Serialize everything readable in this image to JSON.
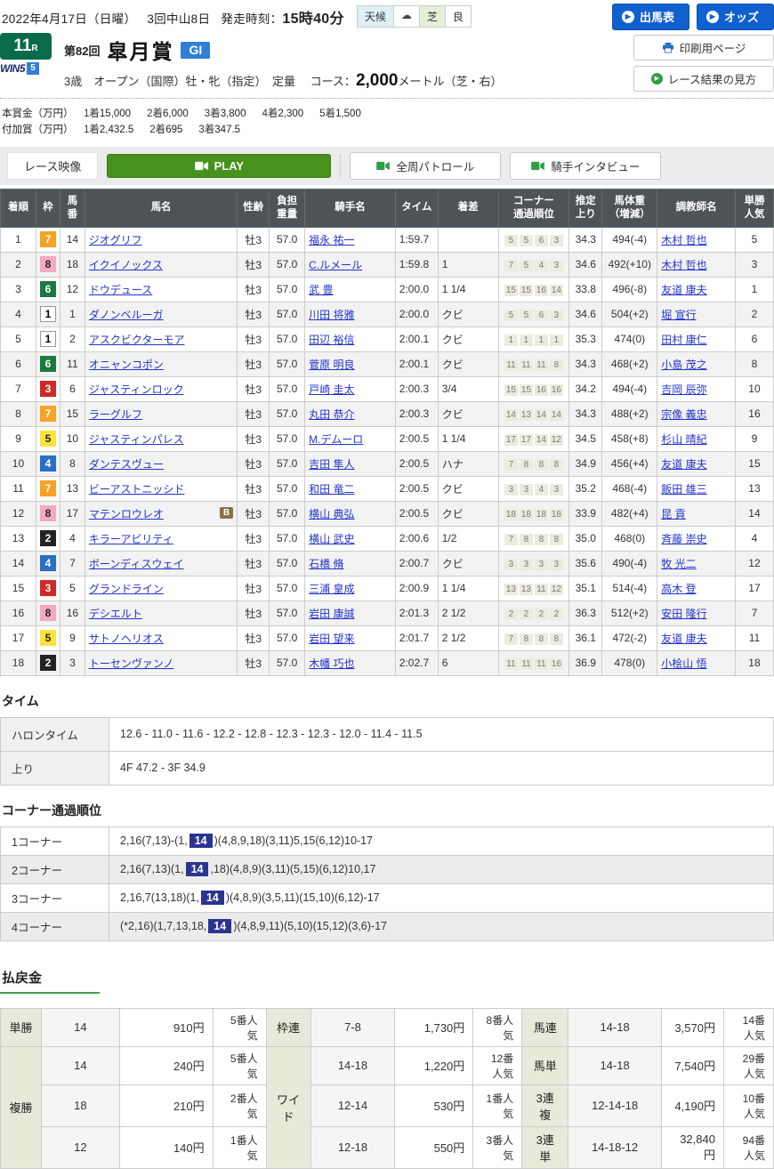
{
  "icons": {
    "play_arrow": "▶",
    "cloud": "☁"
  },
  "header": {
    "date": "2022年4月17日（日曜）",
    "meet": "3回中山8日",
    "start_label": "発走時刻：",
    "start_time": "15時40分",
    "weather_label": "天候",
    "turf_label": "芝",
    "turf_value": "良",
    "btn_entry": "出馬表",
    "btn_odds": "オッズ",
    "btn_print": "印刷用ページ",
    "btn_guide": "レース結果の見方"
  },
  "race": {
    "number": "11",
    "number_suffix": "R",
    "win5": "WIN5",
    "win5_num": "5",
    "edition": "第82回",
    "name": "皐月賞",
    "grade": "GI",
    "conditions": "3歳　オープン（国際）牡・牝（指定）　定量",
    "course_label": "コース：",
    "course_distance": "2,000",
    "course_detail": "メートル（芝・右）"
  },
  "prize": {
    "main_label": "本賞金（万円）",
    "added_label": "付加賞（万円）",
    "main": [
      [
        "1着",
        "15,000"
      ],
      [
        "2着",
        "6,000"
      ],
      [
        "3着",
        "3,800"
      ],
      [
        "4着",
        "2,300"
      ],
      [
        "5着",
        "1,500"
      ]
    ],
    "added": [
      [
        "1着",
        "2,432.5"
      ],
      [
        "2着",
        "695"
      ],
      [
        "3着",
        "347.5"
      ]
    ]
  },
  "video": {
    "race_video": "レース映像",
    "play": "PLAY",
    "patrol": "全周パトロール",
    "interview": "騎手インタビュー"
  },
  "results": {
    "headers": [
      "着順",
      "枠",
      "馬\n番",
      "馬名",
      "性齢",
      "負担\n重量",
      "騎手名",
      "タイム",
      "着差",
      "コーナー\n通過順位",
      "推定\n上り",
      "馬体重\n（増減）",
      "調教師名",
      "単勝\n人気"
    ],
    "rows": [
      {
        "pos": "1",
        "waku": "7",
        "num": "14",
        "name": "ジオグリフ",
        "badge": "",
        "sa": "牡3",
        "wt": "57.0",
        "jockey": "福永 祐一",
        "time": "1:59.7",
        "margin": "",
        "corners": [
          "5",
          "5",
          "6",
          "3"
        ],
        "agari": "34.3",
        "hw": "494(-4)",
        "trainer": "木村 哲也",
        "ninki": "5"
      },
      {
        "pos": "2",
        "waku": "8",
        "num": "18",
        "name": "イクイノックス",
        "badge": "",
        "sa": "牡3",
        "wt": "57.0",
        "jockey": "C.ルメール",
        "time": "1:59.8",
        "margin": "1",
        "corners": [
          "7",
          "5",
          "4",
          "3"
        ],
        "agari": "34.6",
        "hw": "492(+10)",
        "trainer": "木村 哲也",
        "ninki": "3"
      },
      {
        "pos": "3",
        "waku": "6",
        "num": "12",
        "name": "ドウデュース",
        "badge": "",
        "sa": "牡3",
        "wt": "57.0",
        "jockey": "武 豊",
        "time": "2:00.0",
        "margin": "1 1/4",
        "corners": [
          "15",
          "15",
          "16",
          "14"
        ],
        "agari": "33.8",
        "hw": "496(-8)",
        "trainer": "友道 康夫",
        "ninki": "1"
      },
      {
        "pos": "4",
        "waku": "1",
        "num": "1",
        "name": "ダノンベルーガ",
        "badge": "",
        "sa": "牡3",
        "wt": "57.0",
        "jockey": "川田 将雅",
        "time": "2:00.0",
        "margin": "クビ",
        "corners": [
          "5",
          "5",
          "6",
          "3"
        ],
        "agari": "34.6",
        "hw": "504(+2)",
        "trainer": "堀 宣行",
        "ninki": "2"
      },
      {
        "pos": "5",
        "waku": "1",
        "num": "2",
        "name": "アスクビクターモア",
        "badge": "",
        "sa": "牡3",
        "wt": "57.0",
        "jockey": "田辺 裕信",
        "time": "2:00.1",
        "margin": "クビ",
        "corners": [
          "1",
          "1",
          "1",
          "1"
        ],
        "agari": "35.3",
        "hw": "474(0)",
        "trainer": "田村 康仁",
        "ninki": "6"
      },
      {
        "pos": "6",
        "waku": "6",
        "num": "11",
        "name": "オニャンコポン",
        "badge": "",
        "sa": "牡3",
        "wt": "57.0",
        "jockey": "菅原 明良",
        "time": "2:00.1",
        "margin": "クビ",
        "corners": [
          "11",
          "11",
          "11",
          "8"
        ],
        "agari": "34.3",
        "hw": "468(+2)",
        "trainer": "小島 茂之",
        "ninki": "8"
      },
      {
        "pos": "7",
        "waku": "3",
        "num": "6",
        "name": "ジャスティンロック",
        "badge": "",
        "sa": "牡3",
        "wt": "57.0",
        "jockey": "戸崎 圭太",
        "time": "2:00.3",
        "margin": "3/4",
        "corners": [
          "15",
          "15",
          "16",
          "16"
        ],
        "agari": "34.2",
        "hw": "494(-4)",
        "trainer": "吉岡 辰弥",
        "ninki": "10"
      },
      {
        "pos": "8",
        "waku": "7",
        "num": "15",
        "name": "ラーグルフ",
        "badge": "",
        "sa": "牡3",
        "wt": "57.0",
        "jockey": "丸田 恭介",
        "time": "2:00.3",
        "margin": "クビ",
        "corners": [
          "14",
          "13",
          "14",
          "14"
        ],
        "agari": "34.3",
        "hw": "488(+2)",
        "trainer": "宗像 義忠",
        "ninki": "16"
      },
      {
        "pos": "9",
        "waku": "5",
        "num": "10",
        "name": "ジャスティンパレス",
        "badge": "",
        "sa": "牡3",
        "wt": "57.0",
        "jockey": "M.デムーロ",
        "time": "2:00.5",
        "margin": "1 1/4",
        "corners": [
          "17",
          "17",
          "14",
          "12"
        ],
        "agari": "34.5",
        "hw": "458(+8)",
        "trainer": "杉山 晴紀",
        "ninki": "9"
      },
      {
        "pos": "10",
        "waku": "4",
        "num": "8",
        "name": "ダンテスヴュー",
        "badge": "",
        "sa": "牡3",
        "wt": "57.0",
        "jockey": "吉田 隼人",
        "time": "2:00.5",
        "margin": "ハナ",
        "corners": [
          "7",
          "8",
          "8",
          "8"
        ],
        "agari": "34.9",
        "hw": "456(+4)",
        "trainer": "友道 康夫",
        "ninki": "15"
      },
      {
        "pos": "11",
        "waku": "7",
        "num": "13",
        "name": "ビーアストニッシド",
        "badge": "",
        "sa": "牡3",
        "wt": "57.0",
        "jockey": "和田 竜二",
        "time": "2:00.5",
        "margin": "クビ",
        "corners": [
          "3",
          "3",
          "4",
          "3"
        ],
        "agari": "35.2",
        "hw": "468(-4)",
        "trainer": "飯田 雄三",
        "ninki": "13"
      },
      {
        "pos": "12",
        "waku": "8",
        "num": "17",
        "name": "マテンロウレオ",
        "badge": "B",
        "sa": "牡3",
        "wt": "57.0",
        "jockey": "横山 典弘",
        "time": "2:00.5",
        "margin": "クビ",
        "corners": [
          "18",
          "18",
          "18",
          "18"
        ],
        "agari": "33.9",
        "hw": "482(+4)",
        "trainer": "昆 貢",
        "ninki": "14"
      },
      {
        "pos": "13",
        "waku": "2",
        "num": "4",
        "name": "キラーアビリティ",
        "badge": "",
        "sa": "牡3",
        "wt": "57.0",
        "jockey": "横山 武史",
        "time": "2:00.6",
        "margin": "1/2",
        "corners": [
          "7",
          "8",
          "8",
          "8"
        ],
        "agari": "35.0",
        "hw": "468(0)",
        "trainer": "斉藤 崇史",
        "ninki": "4"
      },
      {
        "pos": "14",
        "waku": "4",
        "num": "7",
        "name": "ボーンディスウェイ",
        "badge": "",
        "sa": "牡3",
        "wt": "57.0",
        "jockey": "石橋 脩",
        "time": "2:00.7",
        "margin": "クビ",
        "corners": [
          "3",
          "3",
          "3",
          "3"
        ],
        "agari": "35.6",
        "hw": "490(-4)",
        "trainer": "牧 光二",
        "ninki": "12"
      },
      {
        "pos": "15",
        "waku": "3",
        "num": "5",
        "name": "グランドライン",
        "badge": "",
        "sa": "牡3",
        "wt": "57.0",
        "jockey": "三浦 皇成",
        "time": "2:00.9",
        "margin": "1 1/4",
        "corners": [
          "13",
          "13",
          "11",
          "12"
        ],
        "agari": "35.1",
        "hw": "514(-4)",
        "trainer": "高木 登",
        "ninki": "17"
      },
      {
        "pos": "16",
        "waku": "8",
        "num": "16",
        "name": "デシエルト",
        "badge": "",
        "sa": "牡3",
        "wt": "57.0",
        "jockey": "岩田 康誠",
        "time": "2:01.3",
        "margin": "2 1/2",
        "corners": [
          "2",
          "2",
          "2",
          "2"
        ],
        "agari": "36.3",
        "hw": "512(+2)",
        "trainer": "安田 隆行",
        "ninki": "7"
      },
      {
        "pos": "17",
        "waku": "5",
        "num": "9",
        "name": "サトノヘリオス",
        "badge": "",
        "sa": "牡3",
        "wt": "57.0",
        "jockey": "岩田 望来",
        "time": "2:01.7",
        "margin": "2 1/2",
        "corners": [
          "7",
          "8",
          "8",
          "8"
        ],
        "agari": "36.1",
        "hw": "472(-2)",
        "trainer": "友道 康夫",
        "ninki": "11"
      },
      {
        "pos": "18",
        "waku": "2",
        "num": "3",
        "name": "トーセンヴァンノ",
        "badge": "",
        "sa": "牡3",
        "wt": "57.0",
        "jockey": "木幡 巧也",
        "time": "2:02.7",
        "margin": "6",
        "corners": [
          "11",
          "11",
          "11",
          "16"
        ],
        "agari": "36.9",
        "hw": "478(0)",
        "trainer": "小桧山 悟",
        "ninki": "18"
      }
    ]
  },
  "time_section": {
    "title": "タイム",
    "rows": [
      [
        "ハロンタイム",
        "12.6 - 11.0 - 11.6 - 12.2 - 12.8 - 12.3 - 12.3 - 12.0 - 11.4 - 11.5"
      ],
      [
        "上り",
        "4F 47.2 - 3F 34.9"
      ]
    ]
  },
  "corner_section": {
    "title": "コーナー通過順位",
    "highlight": "14",
    "rows": [
      {
        "label": "1コーナー",
        "pre": "2,16(7,13)-(1,",
        "post": ")(4,8,9,18)(3,11)5,15(6,12)10-17"
      },
      {
        "label": "2コーナー",
        "pre": "2,16(7,13)(1,",
        "post": ",18)(4,8,9)(3,11)(5,15)(6,12)10,17"
      },
      {
        "label": "3コーナー",
        "pre": "2,16,7(13,18)(1,",
        "post": ")(4,8,9)(3,5,11)(15,10)(6,12)-17"
      },
      {
        "label": "4コーナー",
        "pre": "(*2,16)(1,7,13,18,",
        "post": ")(4,8,9,11)(5,10)(15,12)(3,6)-17"
      }
    ]
  },
  "payout": {
    "title": "払戻金",
    "tansho": {
      "label": "単勝",
      "num": "14",
      "pay": "910円",
      "pop": "5番人気"
    },
    "fukusho": {
      "label": "複勝",
      "rows": [
        [
          "14",
          "240円",
          "5番人気"
        ],
        [
          "18",
          "210円",
          "2番人気"
        ],
        [
          "12",
          "140円",
          "1番人気"
        ]
      ]
    },
    "wakuren": {
      "label": "枠連",
      "num": "7-8",
      "pay": "1,730円",
      "pop": "8番人気"
    },
    "wide": {
      "label": "ワイド",
      "rows": [
        [
          "14-18",
          "1,220円",
          "12番人気"
        ],
        [
          "12-14",
          "530円",
          "1番人気"
        ],
        [
          "12-18",
          "550円",
          "3番人気"
        ]
      ]
    },
    "umaren": {
      "label": "馬連",
      "num": "14-18",
      "pay": "3,570円",
      "pop": "14番人気"
    },
    "umatan": {
      "label": "馬単",
      "num": "14-18",
      "pay": "7,540円",
      "pop": "29番人気"
    },
    "sanrenpuku": {
      "label": "3連複",
      "num": "12-14-18",
      "pay": "4,190円",
      "pop": "10番人気"
    },
    "sanrentan": {
      "label": "3連単",
      "num": "14-18-12",
      "pay": "32,840円",
      "pop": "94番人気"
    }
  }
}
